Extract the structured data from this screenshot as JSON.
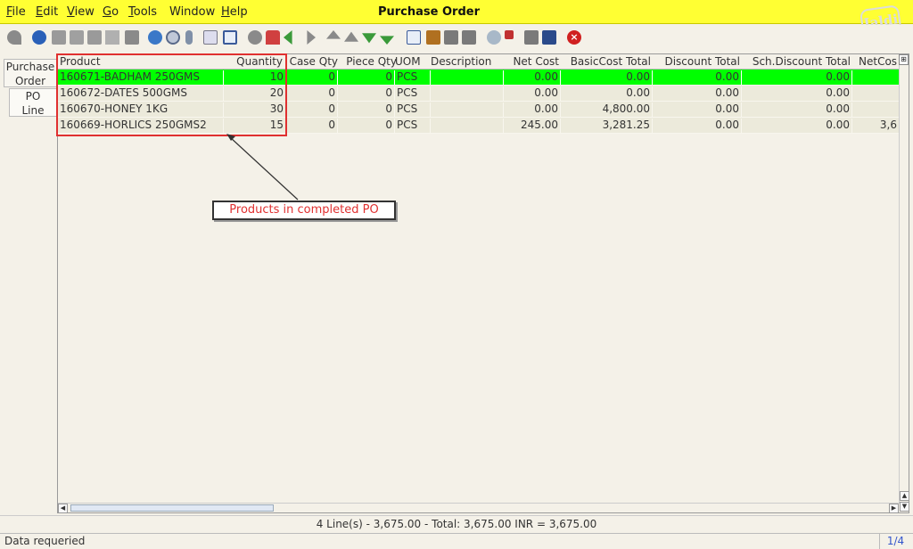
{
  "menu": {
    "items": [
      {
        "label": "File",
        "underline": "F"
      },
      {
        "label": "Edit",
        "underline": "E"
      },
      {
        "label": "View",
        "underline": "V"
      },
      {
        "label": "Go",
        "underline": "G"
      },
      {
        "label": "Tools",
        "underline": "T"
      },
      {
        "label": "Window",
        "underline": ""
      },
      {
        "label": "Help",
        "underline": "H"
      }
    ],
    "title": "Purchase Order",
    "logo_text": "Jaldi"
  },
  "tabs": {
    "purchase_order_line1": "Purchase",
    "purchase_order_line2": "Order",
    "po_line_line1": "PO",
    "po_line_line2": "Line"
  },
  "grid": {
    "columns": [
      "Product",
      "Quantity",
      "Case Qty",
      "Piece Qty",
      "UOM",
      "Description",
      "Net Cost",
      "BasicCost Total",
      "Discount Total",
      "Sch.Discount Total",
      "NetCos"
    ],
    "rows": [
      [
        "160671-BADHAM 250GMS",
        "10",
        "0",
        "0",
        "PCS",
        "",
        "0.00",
        "0.00",
        "0.00",
        "0.00",
        ""
      ],
      [
        "160672-DATES 500GMS",
        "20",
        "0",
        "0",
        "PCS",
        "",
        "0.00",
        "0.00",
        "0.00",
        "0.00",
        ""
      ],
      [
        "160670-HONEY 1KG",
        "30",
        "0",
        "0",
        "PCS",
        "",
        "0.00",
        "4,800.00",
        "0.00",
        "0.00",
        ""
      ],
      [
        "160669-HORLICS 250GMS2",
        "15",
        "0",
        "0",
        "PCS",
        "",
        "245.00",
        "3,281.25",
        "0.00",
        "0.00",
        "3,6"
      ]
    ],
    "selected_row": 0
  },
  "annotation": {
    "label": "Products in completed PO"
  },
  "summary": "4 Line(s) - 3,675.00 -  Total: 3,675.00  INR  =  3,675.00",
  "status": {
    "message": "Data requeried",
    "page": "1/4"
  },
  "colors": {
    "menubar": "#ffff33",
    "selected_row": "#00ff00",
    "annotation": "#e03030"
  }
}
